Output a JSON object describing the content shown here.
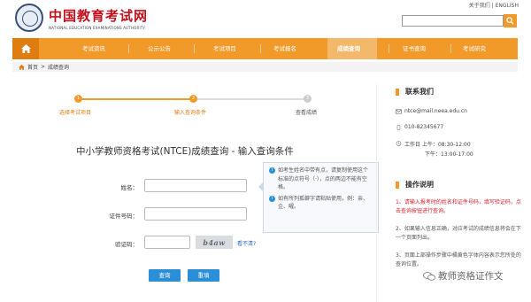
{
  "header": {
    "top_links": "关于我们 | ENGLISH",
    "logo_cn": "中国教育考试网",
    "logo_en": "NATIONAL EDUCATION EXAMINATIONS AUTHORITY",
    "search_value": ""
  },
  "nav": {
    "items": [
      "考试资讯",
      "公示公告",
      "考试项目",
      "考试报名",
      "成绩查询",
      "证书查询",
      "考试研究"
    ],
    "active": "成绩查询"
  },
  "breadcrumb": {
    "home": "首页",
    "sep": ">",
    "current": "成绩查询"
  },
  "steps": [
    {
      "num": "1",
      "label": "选择考试项目"
    },
    {
      "num": "2",
      "label": "输入查询条件"
    },
    {
      "num": "3",
      "label": "查看成绩"
    }
  ],
  "form": {
    "title": "中小学教师资格考试(NTCE)成绩查询 - 输入查询条件",
    "name_label": "姓名：",
    "id_label": "证件号码：",
    "captcha_label": "验证码：",
    "name_value": "",
    "id_value": "",
    "captcha_value": "",
    "captcha_text": "b4aw",
    "refresh_link": "看不清?",
    "query_button": "查询",
    "reset_button": "重填"
  },
  "tip": {
    "line1": "如考生姓名中带有点，请复制使用这个标准的点符号（·），点的两边不能有空格。",
    "line2": "如有所列孤僻字请粘贴使用，例：亲、企、曜。"
  },
  "contact": {
    "title": "联系我们",
    "email": "ntce@mail.neea.edu.cn",
    "phone": "010-82345677",
    "hours_label": "工作日",
    "hours_am": "上午：08:30-12:00",
    "hours_pm": "下午：13:00-17:00"
  },
  "help": {
    "title": "操作说明",
    "step1": "1、请输入报考时的姓名和证件号码，填写验证码，点击查询按钮进行查询。",
    "step2": "2、如果输入信息正确，对应考试的成绩信息将会在下一个页面列出。",
    "step3": "3、页面上部操作步骤中橘黄色字体内容表示您所处的查询位置。"
  },
  "watermark": "教师资格证作文",
  "colors": {
    "accent": "#f19a2a",
    "nav_active": "#f4b86a",
    "button": "#2b8fd7",
    "red": "#d3222a",
    "logo_red": "#c2101c"
  }
}
